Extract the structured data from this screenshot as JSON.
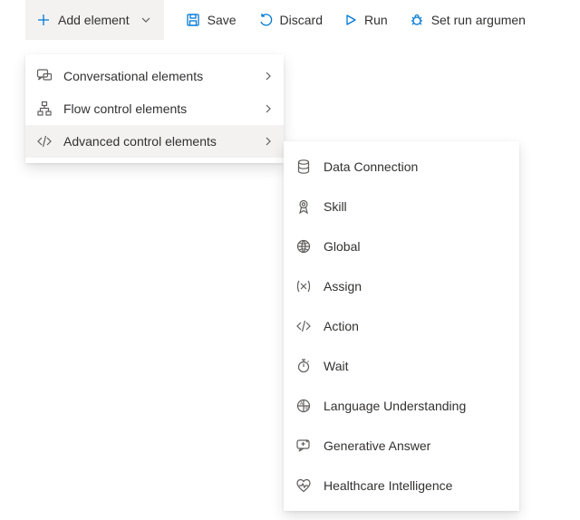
{
  "toolbar": {
    "add_label": "Add element",
    "save_label": "Save",
    "discard_label": "Discard",
    "run_label": "Run",
    "set_args_label": "Set run argumen"
  },
  "menu1": {
    "items": [
      {
        "label": "Conversational elements"
      },
      {
        "label": "Flow control elements"
      },
      {
        "label": "Advanced control elements"
      }
    ]
  },
  "menu2": {
    "items": [
      {
        "label": "Data Connection"
      },
      {
        "label": "Skill"
      },
      {
        "label": "Global"
      },
      {
        "label": "Assign"
      },
      {
        "label": "Action"
      },
      {
        "label": "Wait"
      },
      {
        "label": "Language Understanding"
      },
      {
        "label": "Generative Answer"
      },
      {
        "label": "Healthcare Intelligence"
      }
    ]
  }
}
